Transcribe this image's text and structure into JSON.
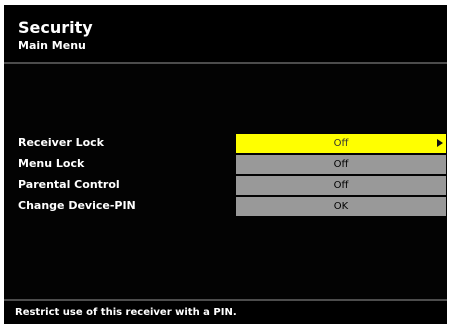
{
  "header": {
    "title": "Security",
    "subtitle": "Main Menu"
  },
  "menu": {
    "items": [
      {
        "label": "Receiver Lock",
        "value": "Off",
        "selected": true
      },
      {
        "label": "Menu Lock",
        "value": "Off",
        "selected": false
      },
      {
        "label": "Parental Control",
        "value": "Off",
        "selected": false
      },
      {
        "label": "Change Device-PIN",
        "value": "OK",
        "selected": false
      }
    ]
  },
  "footer": {
    "help_text": "Restrict use of this receiver with a PIN."
  },
  "colors": {
    "selected_background": "#ffff00",
    "value_background": "#999999",
    "screen_background": "#030303",
    "text": "#ffffff"
  },
  "icons": {
    "selection_arrow": "arrow-right-icon"
  }
}
